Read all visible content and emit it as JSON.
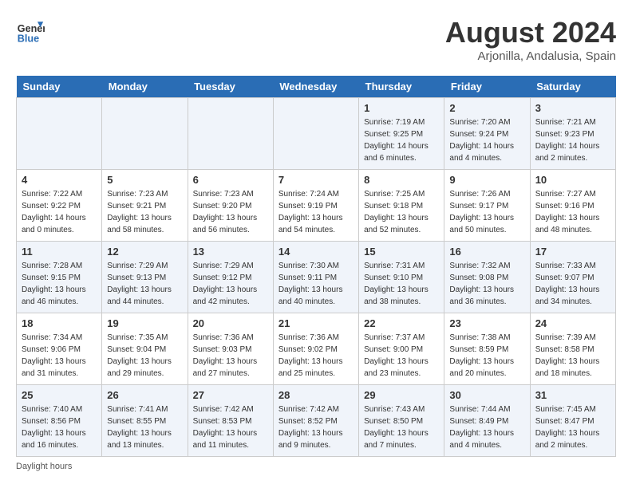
{
  "logo": {
    "general": "General",
    "blue": "Blue"
  },
  "title": "August 2024",
  "location": "Arjonilla, Andalusia, Spain",
  "days_of_week": [
    "Sunday",
    "Monday",
    "Tuesday",
    "Wednesday",
    "Thursday",
    "Friday",
    "Saturday"
  ],
  "footer": "Daylight hours",
  "weeks": [
    [
      {
        "day": "",
        "info": ""
      },
      {
        "day": "",
        "info": ""
      },
      {
        "day": "",
        "info": ""
      },
      {
        "day": "",
        "info": ""
      },
      {
        "day": "1",
        "info": "Sunrise: 7:19 AM\nSunset: 9:25 PM\nDaylight: 14 hours\nand 6 minutes."
      },
      {
        "day": "2",
        "info": "Sunrise: 7:20 AM\nSunset: 9:24 PM\nDaylight: 14 hours\nand 4 minutes."
      },
      {
        "day": "3",
        "info": "Sunrise: 7:21 AM\nSunset: 9:23 PM\nDaylight: 14 hours\nand 2 minutes."
      }
    ],
    [
      {
        "day": "4",
        "info": "Sunrise: 7:22 AM\nSunset: 9:22 PM\nDaylight: 14 hours\nand 0 minutes."
      },
      {
        "day": "5",
        "info": "Sunrise: 7:23 AM\nSunset: 9:21 PM\nDaylight: 13 hours\nand 58 minutes."
      },
      {
        "day": "6",
        "info": "Sunrise: 7:23 AM\nSunset: 9:20 PM\nDaylight: 13 hours\nand 56 minutes."
      },
      {
        "day": "7",
        "info": "Sunrise: 7:24 AM\nSunset: 9:19 PM\nDaylight: 13 hours\nand 54 minutes."
      },
      {
        "day": "8",
        "info": "Sunrise: 7:25 AM\nSunset: 9:18 PM\nDaylight: 13 hours\nand 52 minutes."
      },
      {
        "day": "9",
        "info": "Sunrise: 7:26 AM\nSunset: 9:17 PM\nDaylight: 13 hours\nand 50 minutes."
      },
      {
        "day": "10",
        "info": "Sunrise: 7:27 AM\nSunset: 9:16 PM\nDaylight: 13 hours\nand 48 minutes."
      }
    ],
    [
      {
        "day": "11",
        "info": "Sunrise: 7:28 AM\nSunset: 9:15 PM\nDaylight: 13 hours\nand 46 minutes."
      },
      {
        "day": "12",
        "info": "Sunrise: 7:29 AM\nSunset: 9:13 PM\nDaylight: 13 hours\nand 44 minutes."
      },
      {
        "day": "13",
        "info": "Sunrise: 7:29 AM\nSunset: 9:12 PM\nDaylight: 13 hours\nand 42 minutes."
      },
      {
        "day": "14",
        "info": "Sunrise: 7:30 AM\nSunset: 9:11 PM\nDaylight: 13 hours\nand 40 minutes."
      },
      {
        "day": "15",
        "info": "Sunrise: 7:31 AM\nSunset: 9:10 PM\nDaylight: 13 hours\nand 38 minutes."
      },
      {
        "day": "16",
        "info": "Sunrise: 7:32 AM\nSunset: 9:08 PM\nDaylight: 13 hours\nand 36 minutes."
      },
      {
        "day": "17",
        "info": "Sunrise: 7:33 AM\nSunset: 9:07 PM\nDaylight: 13 hours\nand 34 minutes."
      }
    ],
    [
      {
        "day": "18",
        "info": "Sunrise: 7:34 AM\nSunset: 9:06 PM\nDaylight: 13 hours\nand 31 minutes."
      },
      {
        "day": "19",
        "info": "Sunrise: 7:35 AM\nSunset: 9:04 PM\nDaylight: 13 hours\nand 29 minutes."
      },
      {
        "day": "20",
        "info": "Sunrise: 7:36 AM\nSunset: 9:03 PM\nDaylight: 13 hours\nand 27 minutes."
      },
      {
        "day": "21",
        "info": "Sunrise: 7:36 AM\nSunset: 9:02 PM\nDaylight: 13 hours\nand 25 minutes."
      },
      {
        "day": "22",
        "info": "Sunrise: 7:37 AM\nSunset: 9:00 PM\nDaylight: 13 hours\nand 23 minutes."
      },
      {
        "day": "23",
        "info": "Sunrise: 7:38 AM\nSunset: 8:59 PM\nDaylight: 13 hours\nand 20 minutes."
      },
      {
        "day": "24",
        "info": "Sunrise: 7:39 AM\nSunset: 8:58 PM\nDaylight: 13 hours\nand 18 minutes."
      }
    ],
    [
      {
        "day": "25",
        "info": "Sunrise: 7:40 AM\nSunset: 8:56 PM\nDaylight: 13 hours\nand 16 minutes."
      },
      {
        "day": "26",
        "info": "Sunrise: 7:41 AM\nSunset: 8:55 PM\nDaylight: 13 hours\nand 13 minutes."
      },
      {
        "day": "27",
        "info": "Sunrise: 7:42 AM\nSunset: 8:53 PM\nDaylight: 13 hours\nand 11 minutes."
      },
      {
        "day": "28",
        "info": "Sunrise: 7:42 AM\nSunset: 8:52 PM\nDaylight: 13 hours\nand 9 minutes."
      },
      {
        "day": "29",
        "info": "Sunrise: 7:43 AM\nSunset: 8:50 PM\nDaylight: 13 hours\nand 7 minutes."
      },
      {
        "day": "30",
        "info": "Sunrise: 7:44 AM\nSunset: 8:49 PM\nDaylight: 13 hours\nand 4 minutes."
      },
      {
        "day": "31",
        "info": "Sunrise: 7:45 AM\nSunset: 8:47 PM\nDaylight: 13 hours\nand 2 minutes."
      }
    ]
  ]
}
